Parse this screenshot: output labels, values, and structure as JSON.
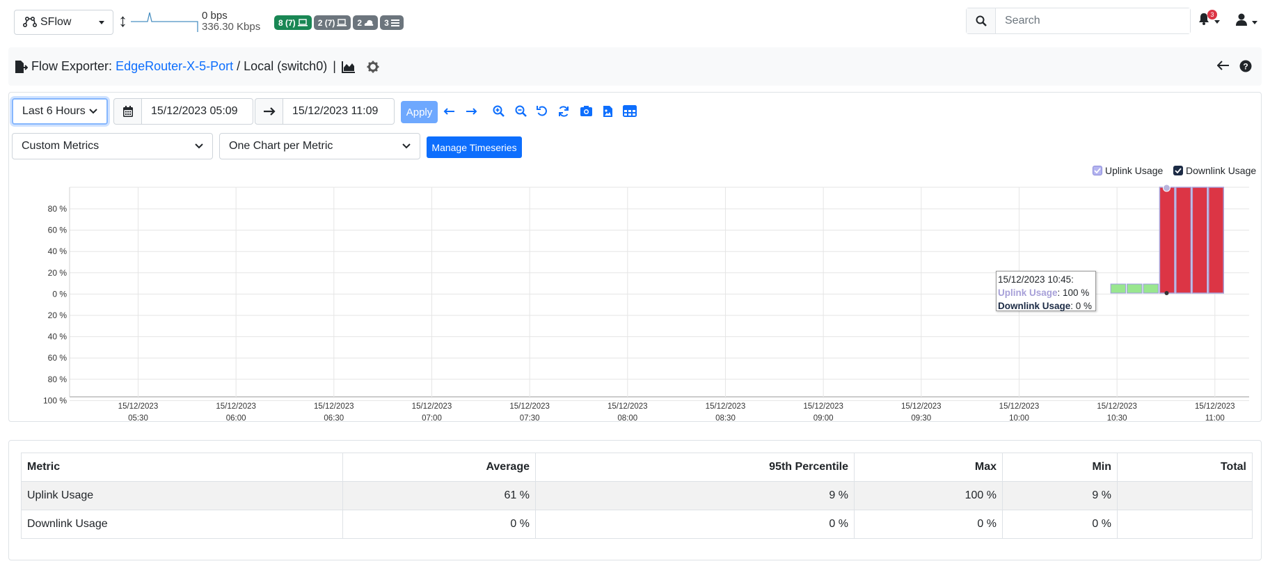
{
  "topbar": {
    "interface_label": "SFlow",
    "traffic_up": "0 bps",
    "traffic_down": "336.30 Kbps",
    "badges": [
      {
        "text": "8 (7)",
        "icon": "laptop-icon",
        "color": "#198754"
      },
      {
        "text": "2 (7)",
        "icon": "laptop-icon",
        "color": "#6c757d"
      },
      {
        "text": "2",
        "icon": "cloud-icon",
        "color": "#6c757d"
      },
      {
        "text": "3",
        "icon": "list-icon",
        "color": "#6c757d"
      }
    ],
    "search_placeholder": "Search",
    "notifications_count": "3"
  },
  "title": {
    "prefix": "Flow Exporter:",
    "device_link": "EdgeRouter-X-5-Port",
    "interface": "/ Local (switch0)",
    "separator": "|"
  },
  "controls": {
    "range_label": "Last 6 Hours",
    "from": "15/12/2023 05:09",
    "to": "15/12/2023 11:09",
    "apply_label": "Apply",
    "metric_select": "Custom Metrics",
    "chart_mode_select": "One Chart per Metric",
    "manage_label": "Manage Timeseries"
  },
  "chart_data": {
    "type": "bar",
    "series": [
      {
        "name": "Uplink Usage",
        "color": "#99e68f",
        "x": [
          "10:30",
          "10:35",
          "10:40",
          "10:45",
          "10:50",
          "10:55",
          "11:00"
        ],
        "values": [
          8,
          8,
          9,
          100,
          100,
          100,
          100
        ]
      },
      {
        "name": "Downlink Usage",
        "color": "#dc3545",
        "x": [
          "10:45",
          "10:50",
          "10:55",
          "11:00"
        ],
        "values": [
          100,
          100,
          100,
          100
        ]
      }
    ],
    "y_ticks_top": [
      "80 %",
      "60 %",
      "40 %",
      "20 %",
      "0 %"
    ],
    "y_ticks_bottom": [
      "20 %",
      "40 %",
      "60 %",
      "80 %",
      "100 %"
    ],
    "x_ticks": [
      {
        "date": "15/12/2023",
        "time": "05:30"
      },
      {
        "date": "15/12/2023",
        "time": "06:00"
      },
      {
        "date": "15/12/2023",
        "time": "06:30"
      },
      {
        "date": "15/12/2023",
        "time": "07:00"
      },
      {
        "date": "15/12/2023",
        "time": "07:30"
      },
      {
        "date": "15/12/2023",
        "time": "08:00"
      },
      {
        "date": "15/12/2023",
        "time": "08:30"
      },
      {
        "date": "15/12/2023",
        "time": "09:00"
      },
      {
        "date": "15/12/2023",
        "time": "09:30"
      },
      {
        "date": "15/12/2023",
        "time": "10:00"
      },
      {
        "date": "15/12/2023",
        "time": "10:30"
      },
      {
        "date": "15/12/2023",
        "time": "11:00"
      }
    ],
    "legend": [
      "Uplink Usage",
      "Downlink Usage"
    ],
    "tooltip": {
      "title": "15/12/2023 10:45:",
      "uplink_label": "Uplink Usage",
      "uplink_value": ": 100 %",
      "downlink_label": "Downlink Usage",
      "downlink_value": ": 0 %"
    }
  },
  "stats_table": {
    "headers": [
      "Metric",
      "Average",
      "95th Percentile",
      "Max",
      "Min",
      "Total"
    ],
    "rows": [
      [
        "Uplink Usage",
        "61 %",
        "9 %",
        "100 %",
        "9 %",
        ""
      ],
      [
        "Downlink Usage",
        "0 %",
        "0 %",
        "0 %",
        "0 %",
        ""
      ]
    ]
  }
}
